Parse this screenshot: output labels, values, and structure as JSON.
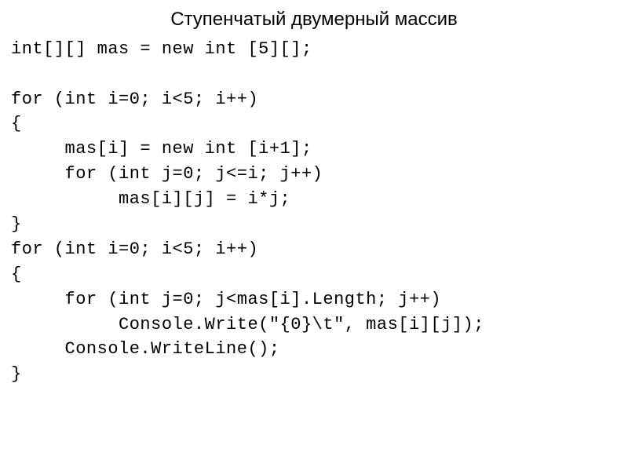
{
  "title": "Ступенчатый двумерный массив",
  "code_lines": [
    "int[][] mas = new int [5][];",
    "",
    "for (int i=0; i<5; i++)",
    "{",
    "     mas[i] = new int [i+1];",
    "     for (int j=0; j<=i; j++)",
    "          mas[i][j] = i*j;",
    "}",
    "for (int i=0; i<5; i++)",
    "{",
    "     for (int j=0; j<mas[i].Length; j++)",
    "          Console.Write(\"{0}\\t\", mas[i][j]);",
    "     Console.WriteLine();",
    "}"
  ]
}
